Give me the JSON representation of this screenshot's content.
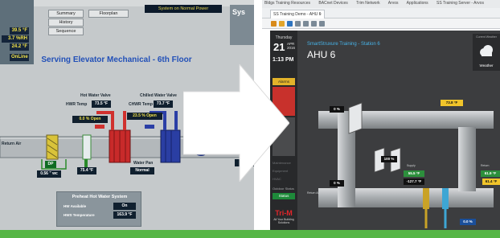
{
  "legacy": {
    "status_values": [
      "39.5 °F",
      "3.7 %RH",
      "24.2 °F",
      "OnLine"
    ],
    "nav_buttons": [
      "Summary",
      "History",
      "Sequence",
      "Floorplan"
    ],
    "system_banner": "System on Normal Power",
    "system_label": "Sys",
    "title": "Serving Elevator Mechanical - 6th Floor",
    "hot_water_valve_label": "Hot Water Valve",
    "chilled_water_valve_label": "Chilled Water Valve",
    "hwr_temp_label": "HWR Temp",
    "hwr_temp_value": "73.5 °F",
    "chwr_temp_label": "CHWR Temp",
    "chwr_temp_value": "73.7 °F",
    "hw_valve_open": "0.0 % Open",
    "chw_valve_open": "23.5 % Open",
    "dp_label": "DP",
    "dp_value": "0.56 \" wc",
    "sat_value": "75.4 °F",
    "water_pan_label": "Water Pan",
    "water_pan_value": "Normal",
    "sat_right_value": "73.4",
    "intake_label": "Return Air",
    "preheat": {
      "title": "Preheat Hot Water System",
      "row1_label": "HW Available",
      "row1_value": "On",
      "row2_label": "HWS Temperature",
      "row2_value": "163.9 °F"
    }
  },
  "browser": {
    "bookmarks": [
      "Bldgs Training Resources",
      "BACnet Devices",
      "Trim Network",
      "Arvos",
      "Applications",
      "SS Training Server - Arvos"
    ],
    "tab_title": "SS Training Demo - AHU 6"
  },
  "app": {
    "day": "Thursday",
    "date": "21",
    "month": "APR",
    "year": "2016",
    "time": "1:13 PM",
    "alarm_label": "Alarms",
    "side_items": [
      "Maintenance",
      "Equipment",
      "HVAC"
    ],
    "outdoor_status_label": "Outdoor Status",
    "status_button": "Status",
    "brand": "Tri-M",
    "brand_sub": "All Your Building Solutions",
    "breadcrumb": "SmartStruxure Training - Station 6",
    "unit_name": "AHU 6",
    "weather_label": "Current Weather",
    "weather_text": "Weather",
    "values": {
      "top_temp": "73.8 °F",
      "damper_top": "0 %",
      "damper_mid": "0 %",
      "fan_speed": "100 %",
      "sat": "55.5 °F",
      "sat_sp": "-127.7 °F",
      "return_right": "61.9 °F",
      "right_bottom": "61.4 °F",
      "valve_pct": "0.0 %",
      "return_label": "Return Air",
      "supply_label": "Supply",
      "return_small": "Return"
    }
  },
  "colors": {
    "legacy_bg": "#c5c9cb",
    "legacy_title": "#2250b8",
    "hw_valve": "#d0312e",
    "chw_valve": "#2b3fa6",
    "app_bg": "#3c3d3f",
    "brand_red": "#e2262b",
    "accent_blue": "#47b3e8",
    "accent_yellow": "#f0c42a",
    "band_green": "#56b646"
  }
}
